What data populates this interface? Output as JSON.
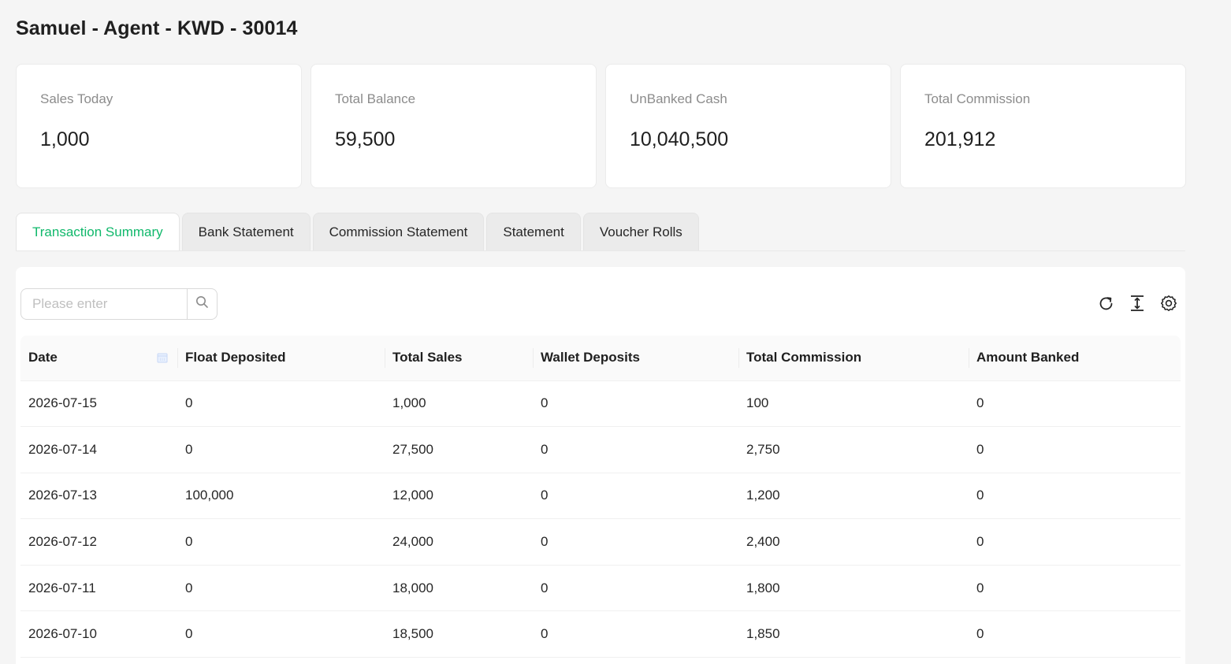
{
  "page": {
    "title": "Samuel - Agent - KWD - 30014"
  },
  "stats": [
    {
      "label": "Sales Today",
      "value": "1,000"
    },
    {
      "label": "Total Balance",
      "value": "59,500"
    },
    {
      "label": "UnBanked Cash",
      "value": "10,040,500"
    },
    {
      "label": "Total Commission",
      "value": "201,912"
    }
  ],
  "tabs": [
    {
      "label": "Transaction Summary",
      "active": true
    },
    {
      "label": "Bank Statement",
      "active": false
    },
    {
      "label": "Commission Statement",
      "active": false
    },
    {
      "label": "Statement",
      "active": false
    },
    {
      "label": "Voucher Rolls",
      "active": false
    }
  ],
  "search": {
    "placeholder": "Please enter",
    "value": ""
  },
  "toolbar": {
    "icons": [
      "reload-icon",
      "column-height-icon",
      "settings-icon"
    ]
  },
  "table": {
    "columns": [
      "Date",
      "Float Deposited",
      "Total Sales",
      "Wallet Deposits",
      "Total Commission",
      "Amount Banked"
    ],
    "rows": [
      [
        "2026-07-15",
        "0",
        "1,000",
        "0",
        "100",
        "0"
      ],
      [
        "2026-07-14",
        "0",
        "27,500",
        "0",
        "2,750",
        "0"
      ],
      [
        "2026-07-13",
        "100,000",
        "12,000",
        "0",
        "1,200",
        "0"
      ],
      [
        "2026-07-12",
        "0",
        "24,000",
        "0",
        "2,400",
        "0"
      ],
      [
        "2026-07-11",
        "0",
        "18,000",
        "0",
        "1,800",
        "0"
      ],
      [
        "2026-07-10",
        "0",
        "18,500",
        "0",
        "1,850",
        "0"
      ]
    ]
  },
  "colors": {
    "accent": "#10b86b",
    "background": "#f5f5f5",
    "card": "#ffffff"
  }
}
